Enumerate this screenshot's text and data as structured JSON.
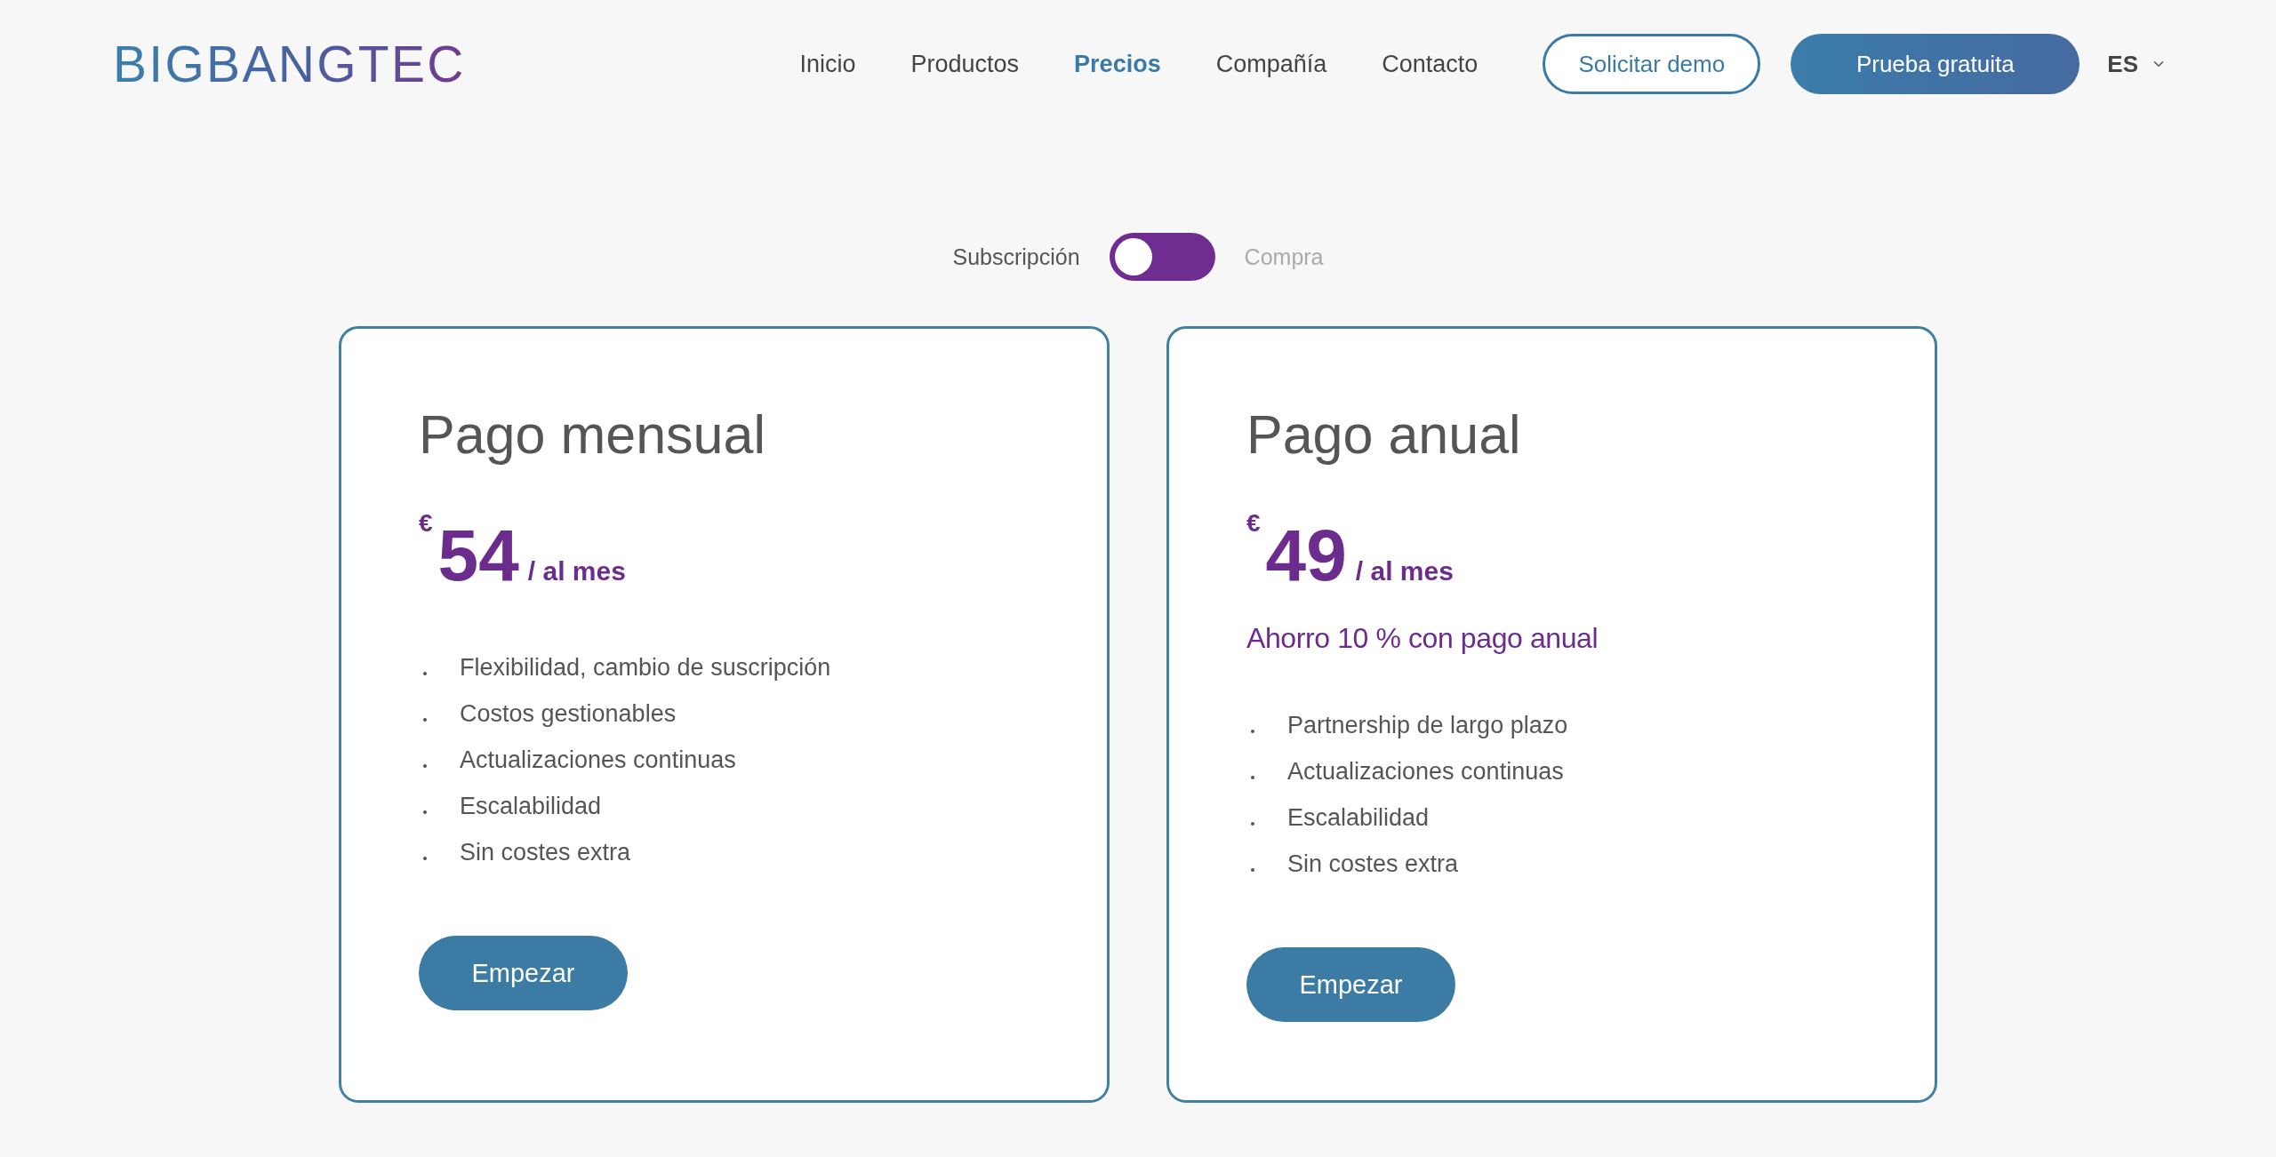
{
  "header": {
    "logo": "BIGBANGTEC",
    "nav": [
      {
        "label": "Inicio",
        "selected": false
      },
      {
        "label": "Productos",
        "selected": false
      },
      {
        "label": "Precios",
        "selected": true
      },
      {
        "label": "Compañía",
        "selected": false
      },
      {
        "label": "Contacto",
        "selected": false
      }
    ],
    "demo_button": "Solicitar demo",
    "trial_button": "Prueba gratuita",
    "language": "ES"
  },
  "billing_toggle": {
    "options": [
      {
        "label": "Subscripción",
        "selected": true
      },
      {
        "label": "Compra",
        "selected": false
      }
    ]
  },
  "plans": [
    {
      "title": "Pago mensual",
      "currency": "€",
      "price": "54",
      "period": "/ al mes",
      "features": [
        "Flexibilidad, cambio de suscripción",
        "Costos gestionables",
        "Actualizaciones continuas",
        "Escalabilidad",
        "Sin costes extra"
      ],
      "button": "Empezar"
    },
    {
      "title": "Pago anual",
      "currency": "€",
      "price": "49",
      "period": "/ al mes",
      "savings": "Ahorro 10 % con pago anual",
      "features": [
        "Partnership de largo plazo",
        "Actualizaciones continuas",
        "Escalabilidad",
        "Sin costes extra"
      ],
      "button": "Empezar"
    }
  ]
}
